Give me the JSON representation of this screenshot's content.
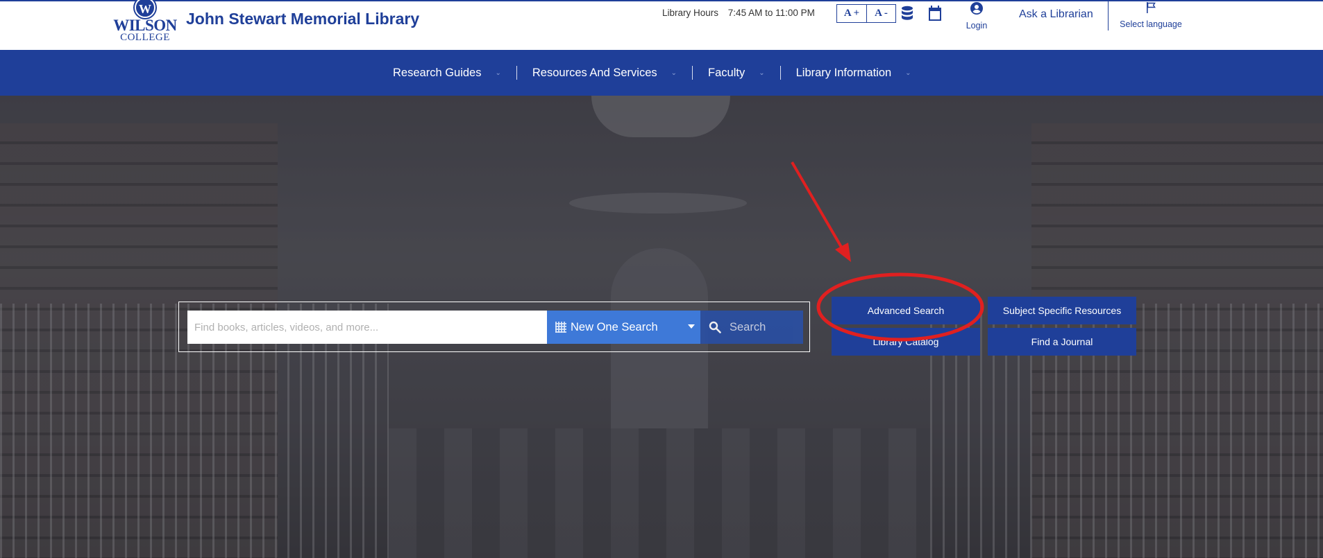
{
  "header": {
    "logo_line1": "WILSON",
    "logo_line2": "COLLEGE",
    "logo_badge": "W",
    "title": "John Stewart Memorial Library",
    "hours_label": "Library Hours",
    "hours_value": "7:45 AM to 11:00 PM",
    "font_increase": "A +",
    "font_decrease": "A -",
    "login_label": "Login",
    "ask_label": "Ask a Librarian",
    "language_label": "Select language"
  },
  "nav": {
    "items": [
      {
        "label": "Research Guides"
      },
      {
        "label": "Resources And Services"
      },
      {
        "label": "Faculty"
      },
      {
        "label": "Library Information"
      }
    ]
  },
  "search": {
    "placeholder": "Find books, articles, videos, and more...",
    "scope_selected": "New One Search",
    "button_label": "Search"
  },
  "quick_links": {
    "advanced_search": "Advanced Search",
    "subject_resources": "Subject Specific Resources",
    "library_catalog": "Library Catalog",
    "find_journal": "Find a Journal"
  },
  "colors": {
    "brand_blue": "#1f3f99",
    "select_blue": "#3e79d8",
    "annotation_red": "#e02020"
  },
  "icons": [
    "database-icon",
    "calendar-icon",
    "user-icon",
    "flag-icon",
    "search-icon",
    "grid-icon",
    "chevron-down-icon",
    "caret-down-icon"
  ]
}
